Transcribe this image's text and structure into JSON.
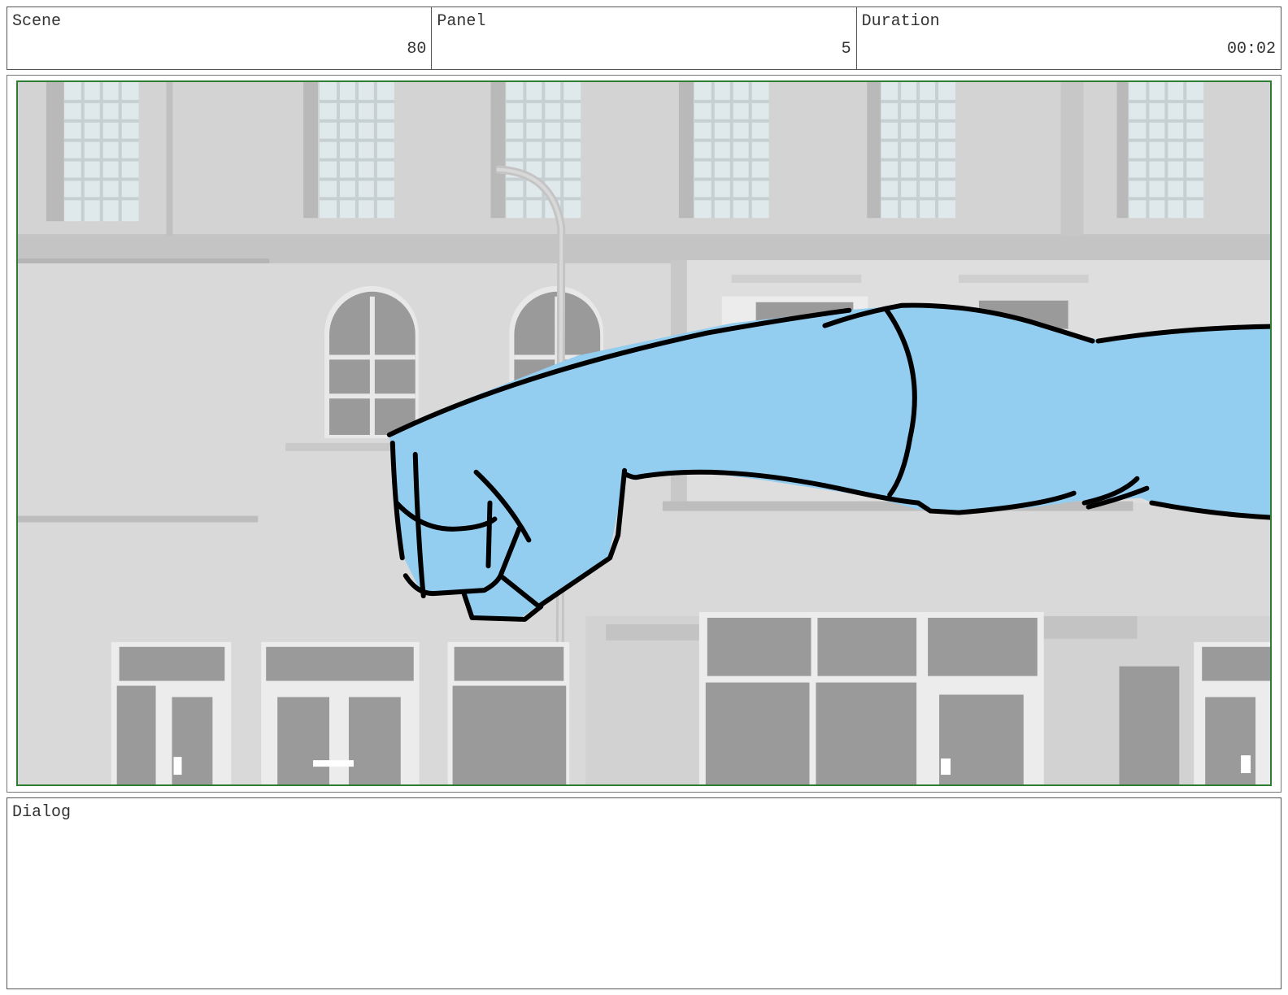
{
  "header": {
    "scene_label": "Scene",
    "scene_value": "80",
    "panel_label": "Panel",
    "panel_value": "5",
    "duration_label": "Duration",
    "duration_value": "00:02"
  },
  "dialog": {
    "label": "Dialog",
    "text": ""
  },
  "panel_image": {
    "frame_color": "#2e7d32",
    "arm_fill_color": "#93cdf0",
    "outline_color": "#000000"
  }
}
